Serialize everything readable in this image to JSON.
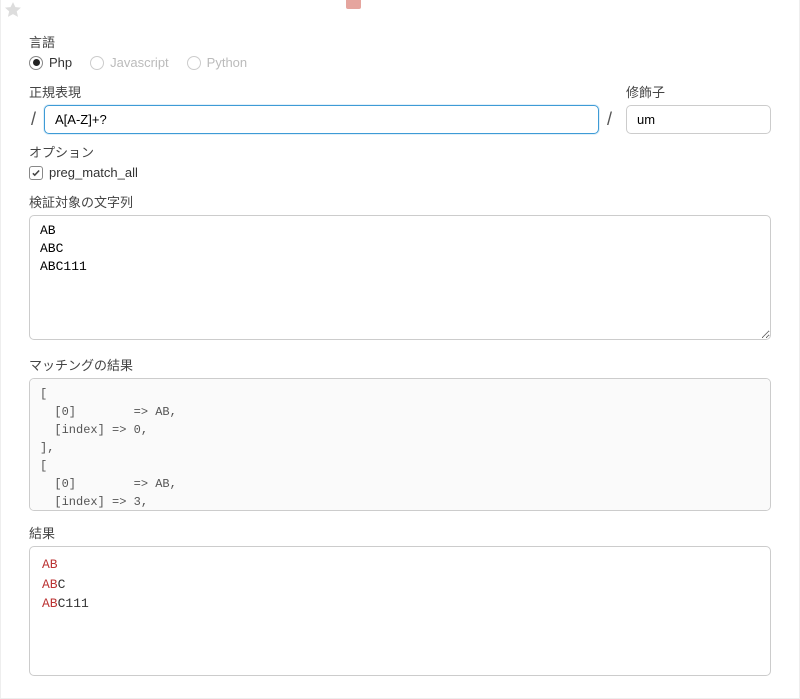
{
  "labels": {
    "language": "言語",
    "regex": "正規表現",
    "modifier": "修飾子",
    "options": "オプション",
    "preg_match_all": "preg_match_all",
    "test_string": "検証対象の文字列",
    "match_result": "マッチングの結果",
    "result": "結果"
  },
  "languages": {
    "php": "Php",
    "javascript": "Javascript",
    "python": "Python",
    "selected": "php"
  },
  "regex": {
    "pattern": "A[A-Z]+?",
    "modifiers": "um"
  },
  "options": {
    "preg_match_all_checked": true
  },
  "test_string": "AB\nABC\nABC111",
  "match_output": "[\n  [0]        => AB,\n  [index] => 0,\n],\n[\n  [0]        => AB,\n  [index] => 3,\n],",
  "result_lines": [
    {
      "hl": "AB",
      "rest": ""
    },
    {
      "hl": "AB",
      "rest": "C"
    },
    {
      "hl": "AB",
      "rest": "C111"
    }
  ]
}
